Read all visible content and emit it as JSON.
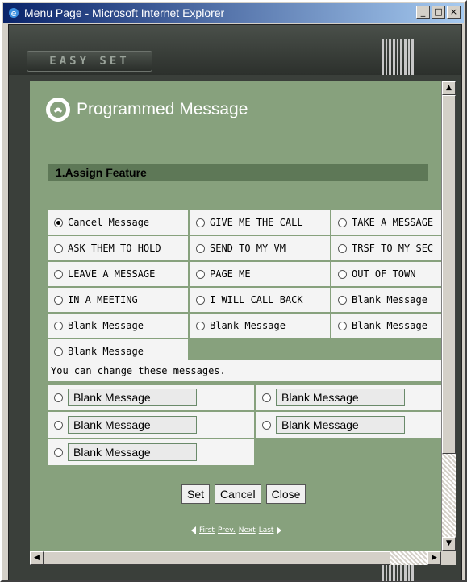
{
  "window": {
    "title": "Menu Page - Microsoft Internet Explorer",
    "minimize": "_",
    "maximize": "□",
    "close": "×"
  },
  "app": {
    "logo": "EASY SET"
  },
  "page": {
    "heading": "Programmed Message",
    "section": "1.Assign Feature",
    "messages": [
      {
        "label": "Cancel Message",
        "checked": true
      },
      {
        "label": "GIVE ME THE CALL",
        "checked": false
      },
      {
        "label": "TAKE A MESSAGE",
        "checked": false
      },
      {
        "label": "ASK THEM TO HOLD",
        "checked": false
      },
      {
        "label": "SEND TO MY VM",
        "checked": false
      },
      {
        "label": "TRSF TO MY SEC",
        "checked": false
      },
      {
        "label": "LEAVE A MESSAGE",
        "checked": false
      },
      {
        "label": "PAGE ME",
        "checked": false
      },
      {
        "label": "OUT OF TOWN",
        "checked": false
      },
      {
        "label": "IN A MEETING",
        "checked": false
      },
      {
        "label": "I WILL CALL BACK",
        "checked": false
      },
      {
        "label": " Blank Message",
        "checked": false
      },
      {
        "label": " Blank Message",
        "checked": false
      },
      {
        "label": " Blank Message",
        "checked": false
      },
      {
        "label": " Blank Message",
        "checked": false
      },
      {
        "label": " Blank Message",
        "checked": false
      }
    ],
    "note": "You can change these messages.",
    "editable": [
      {
        "value": "Blank Message"
      },
      {
        "value": "Blank Message"
      },
      {
        "value": "Blank Message"
      },
      {
        "value": "Blank Message"
      },
      {
        "value": "Blank Message"
      }
    ],
    "buttons": {
      "set": "Set",
      "cancel": "Cancel",
      "close": "Close"
    },
    "pager": {
      "first": "First",
      "prev": "Prev.",
      "next": "Next",
      "last": "Last"
    }
  },
  "icons": {
    "app": "ie-icon",
    "heading": "phone-icon",
    "prev": "triangle-left-icon",
    "next": "triangle-right-icon"
  },
  "colors": {
    "content_bg": "#87a17d",
    "section_bg": "#5e7857",
    "titlebar": "#0a246a"
  }
}
